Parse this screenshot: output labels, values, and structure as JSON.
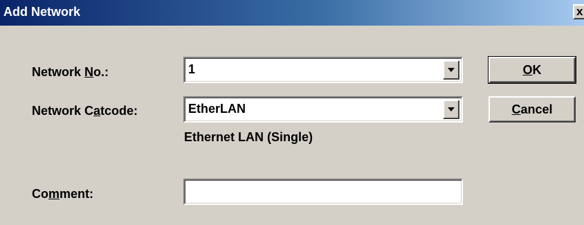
{
  "window": {
    "title": "Add Network",
    "close_glyph": "x"
  },
  "fields": {
    "network_no": {
      "label_pre": "Network ",
      "label_mnemonic": "N",
      "label_post": "o.:",
      "value": "1"
    },
    "network_catcode": {
      "label_pre": "Network C",
      "label_mnemonic": "a",
      "label_post": "tcode:",
      "value": "EtherLAN",
      "description": "Ethernet LAN (Single)"
    },
    "comment": {
      "label_pre": "Co",
      "label_mnemonic": "m",
      "label_post": "ment:",
      "value": ""
    }
  },
  "buttons": {
    "ok": {
      "mnemonic": "O",
      "rest": "K"
    },
    "cancel": {
      "mnemonic": "C",
      "rest": "ancel"
    }
  },
  "icons": {
    "dropdown": "chevron-down-icon",
    "close": "close-icon"
  }
}
